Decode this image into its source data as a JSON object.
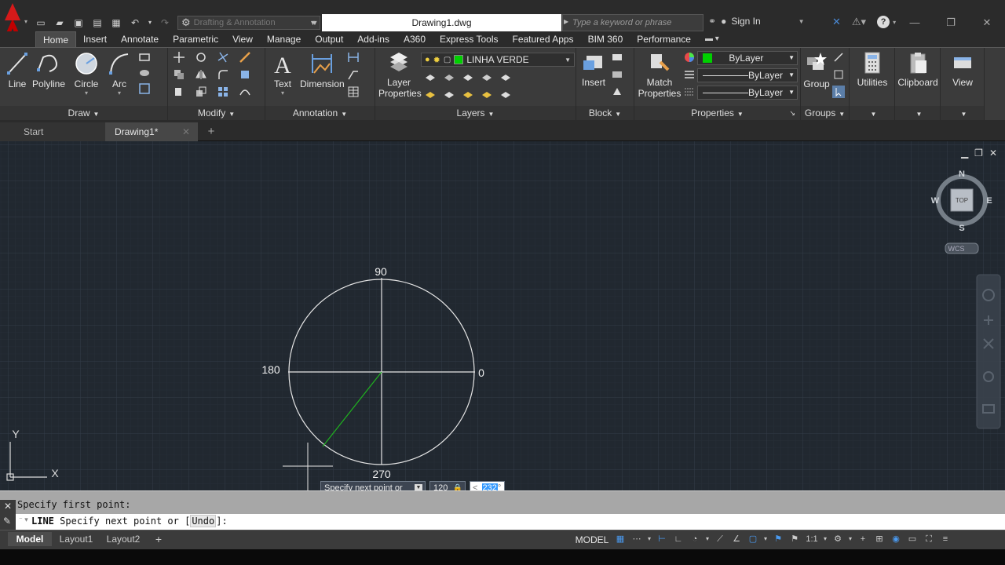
{
  "app": {
    "doc_title": "Drawing1.dwg",
    "workspace": "Drafting & Annotation",
    "search_placeholder": "Type a keyword or phrase",
    "sign_in": "Sign In"
  },
  "ribbon_tabs": [
    "Home",
    "Insert",
    "Annotate",
    "Parametric",
    "View",
    "Manage",
    "Output",
    "Add-ins",
    "A360",
    "Express Tools",
    "Featured Apps",
    "BIM 360",
    "Performance"
  ],
  "ribbon": {
    "draw": {
      "label": "Draw",
      "line": "Line",
      "polyline": "Polyline",
      "circle": "Circle",
      "arc": "Arc"
    },
    "modify": {
      "label": "Modify"
    },
    "annotation": {
      "label": "Annotation",
      "text": "Text",
      "dimension": "Dimension"
    },
    "layers": {
      "label": "Layers",
      "layer_properties_1": "Layer",
      "layer_properties_2": "Properties",
      "current_layer": "LINHA VERDE",
      "layer_color": "#00d000"
    },
    "block": {
      "label": "Block",
      "insert": "Insert"
    },
    "properties": {
      "label": "Properties",
      "match_1": "Match",
      "match_2": "Properties",
      "color": "ByLayer",
      "linetype": "ByLayer",
      "lineweight": "ByLayer",
      "color_swatch": "#00d000"
    },
    "groups": {
      "label": "Groups",
      "group": "Group"
    },
    "utilities": "Utilities",
    "clipboard": "Clipboard",
    "view": "View"
  },
  "file_tabs": {
    "start": "Start",
    "drawing": "Drawing1*"
  },
  "viewcube": {
    "n": "N",
    "s": "S",
    "e": "E",
    "w": "W",
    "face": "TOP",
    "ucs": "WCS"
  },
  "drawing": {
    "angle_labels": {
      "top": "90",
      "left": "180",
      "right": "0",
      "bottom": "270"
    },
    "line_color": "#1fb31f",
    "ucs_x": "X",
    "ucs_y": "Y"
  },
  "dynamic_input": {
    "prompt": "Specify next point or",
    "length": "120",
    "angle_prefix": "<",
    "angle": "232",
    "angle_unit": "°"
  },
  "command": {
    "history": "Specify first point:",
    "current_prefix": "LINE",
    "current_text": "Specify next point or [",
    "option": "Undo",
    "current_suffix": "]:"
  },
  "layout_tabs": [
    "Model",
    "Layout1",
    "Layout2"
  ],
  "status": {
    "model": "MODEL",
    "scale": "1:1"
  }
}
